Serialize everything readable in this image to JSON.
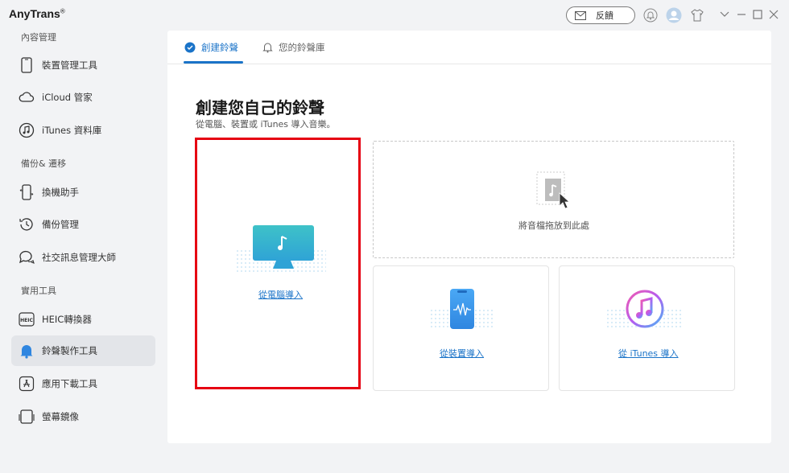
{
  "app": {
    "title": "AnyTrans",
    "trademark": "®"
  },
  "titlebar": {
    "feedback_label": "反饋"
  },
  "sidebar": {
    "sections": [
      {
        "label": "內容管理"
      },
      {
        "label": "備份& 遷移"
      },
      {
        "label": "實用工具"
      }
    ],
    "items": [
      {
        "label": "裝置管理工具",
        "icon": "phone-icon"
      },
      {
        "label": "iCloud 管家",
        "icon": "cloud-icon"
      },
      {
        "label": "iTunes 資料庫",
        "icon": "music-note-icon"
      },
      {
        "label": "換機助手",
        "icon": "phone-transfer-icon"
      },
      {
        "label": "備份管理",
        "icon": "clock-history-icon"
      },
      {
        "label": "社交訊息管理大師",
        "icon": "chat-icon"
      },
      {
        "label": "HEIC轉換器",
        "icon": "heic-icon"
      },
      {
        "label": "鈴聲製作工具",
        "icon": "bell-icon",
        "active": true
      },
      {
        "label": "應用下載工具",
        "icon": "app-store-icon"
      },
      {
        "label": "螢幕鏡像",
        "icon": "screen-mirror-icon"
      }
    ],
    "collapse": "‹"
  },
  "tabs": [
    {
      "label": "創建鈴聲",
      "active": true
    },
    {
      "label": "您的鈴聲庫",
      "active": false
    }
  ],
  "main": {
    "title": "創建您自己的鈴聲",
    "subtitle": "從電腦、裝置或 iTunes 導入音樂。",
    "import_computer": "從電腦導入",
    "drop_hint": "將音檔拖放到此處",
    "import_device": "從裝置導入",
    "import_itunes": "從 iTunes 導入"
  },
  "colors": {
    "accent": "#1a73c8",
    "highlight_border": "#e60012",
    "active_nav_bg": "#e3e5e9"
  }
}
